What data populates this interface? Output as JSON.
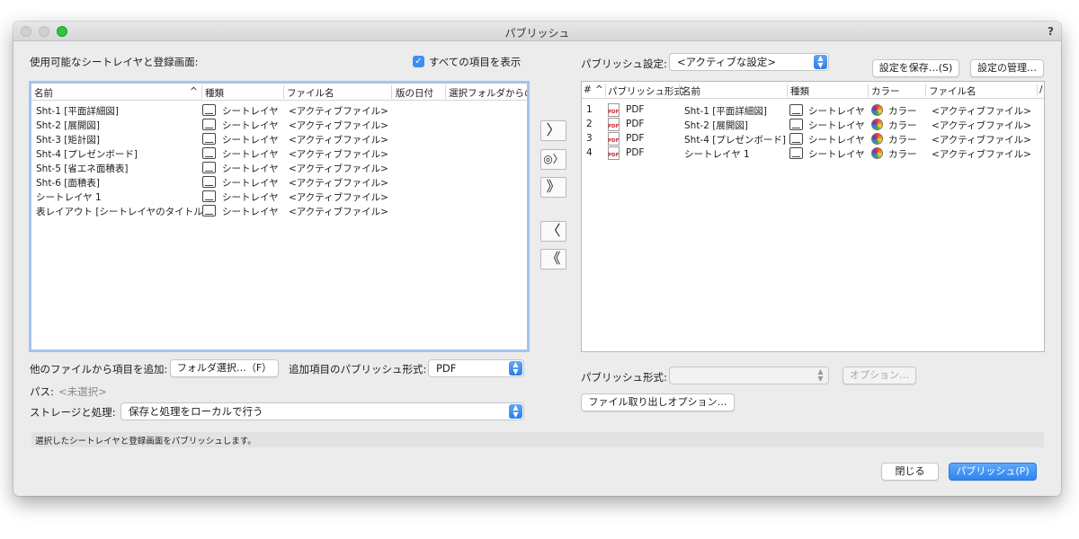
{
  "window": {
    "title": "パブリッシュ",
    "help": "?"
  },
  "left": {
    "heading": "使用可能なシートレイヤと登録画面:",
    "show_all_label": "すべての項目を表示",
    "show_all_checked": true,
    "columns": [
      "名前",
      "種類",
      "ファイル名",
      "版の日付",
      "選択フォルダからの/"
    ],
    "sort_indicator": "^",
    "rows": [
      {
        "name": "Sht-1 [平面詳細図]",
        "type": "シートレイヤ",
        "file": "<アクティブファイル>"
      },
      {
        "name": "Sht-2 [展開図]",
        "type": "シートレイヤ",
        "file": "<アクティブファイル>"
      },
      {
        "name": "Sht-3 [矩計図]",
        "type": "シートレイヤ",
        "file": "<アクティブファイル>"
      },
      {
        "name": "Sht-4 [プレゼンボード]",
        "type": "シートレイヤ",
        "file": "<アクティブファイル>"
      },
      {
        "name": "Sht-5 [省エネ面積表]",
        "type": "シートレイヤ",
        "file": "<アクティブファイル>"
      },
      {
        "name": "Sht-6 [面積表]",
        "type": "シートレイヤ",
        "file": "<アクティブファイル>"
      },
      {
        "name": "シートレイヤ 1",
        "type": "シートレイヤ",
        "file": "<アクティブファイル>"
      },
      {
        "name": "表レイアウト [シートレイヤのタイトル]",
        "type": "シートレイヤ",
        "file": "<アクティブファイル>"
      }
    ],
    "add_from_other_label": "他のファイルから項目を追加:",
    "folder_button": "フォルダ選択…（F）",
    "added_format_label": "追加項目のパブリッシュ形式:",
    "added_format_value": "PDF",
    "path_label": "パス:",
    "path_value": "<未選択>",
    "storage_label": "ストレージと処理:",
    "storage_value": "保存と処理をローカルで行う"
  },
  "middle": {
    "add_icon": "chevron-right-icon",
    "add_glyph": "〉",
    "add_special_glyph": "◎〉",
    "add_all_glyph": "》",
    "remove_glyph": "〈",
    "remove_all_glyph": "《"
  },
  "right": {
    "settings_label": "パブリッシュ設定:",
    "settings_value": "<アクティブな設定>",
    "save_settings_button": "設定を保存…(S)",
    "manage_settings_button": "設定の管理…",
    "columns": [
      "#",
      "パブリッシュ形式",
      "名前",
      "種類",
      "カラー",
      "ファイル名",
      "/"
    ],
    "sort_indicator": "^",
    "rows": [
      {
        "num": "1",
        "format": "PDF",
        "name": "Sht-1 [平面詳細図]",
        "type": "シートレイヤ",
        "color": "カラー",
        "file": "<アクティブファイル>"
      },
      {
        "num": "2",
        "format": "PDF",
        "name": "Sht-2 [展開図]",
        "type": "シートレイヤ",
        "color": "カラー",
        "file": "<アクティブファイル>"
      },
      {
        "num": "3",
        "format": "PDF",
        "name": "Sht-4 [プレゼンボード]",
        "type": "シートレイヤ",
        "color": "カラー",
        "file": "<アクティブファイル>"
      },
      {
        "num": "4",
        "format": "PDF",
        "name": "シートレイヤ 1",
        "type": "シートレイヤ",
        "color": "カラー",
        "file": "<アクティブファイル>"
      }
    ],
    "format_label": "パブリッシュ形式:",
    "format_value": "",
    "options_button": "オプション…",
    "file_export_button": "ファイル取り出しオプション…"
  },
  "status": {
    "text": "選択したシートレイヤと登録画面をパブリッシュします。"
  },
  "footer": {
    "close_button": "閉じる",
    "publish_button": "パブリッシュ(P)"
  },
  "colors": {
    "accent": "#2f84f0",
    "window_bg": "#ececec",
    "focus_ring": "#a4c4ec"
  }
}
